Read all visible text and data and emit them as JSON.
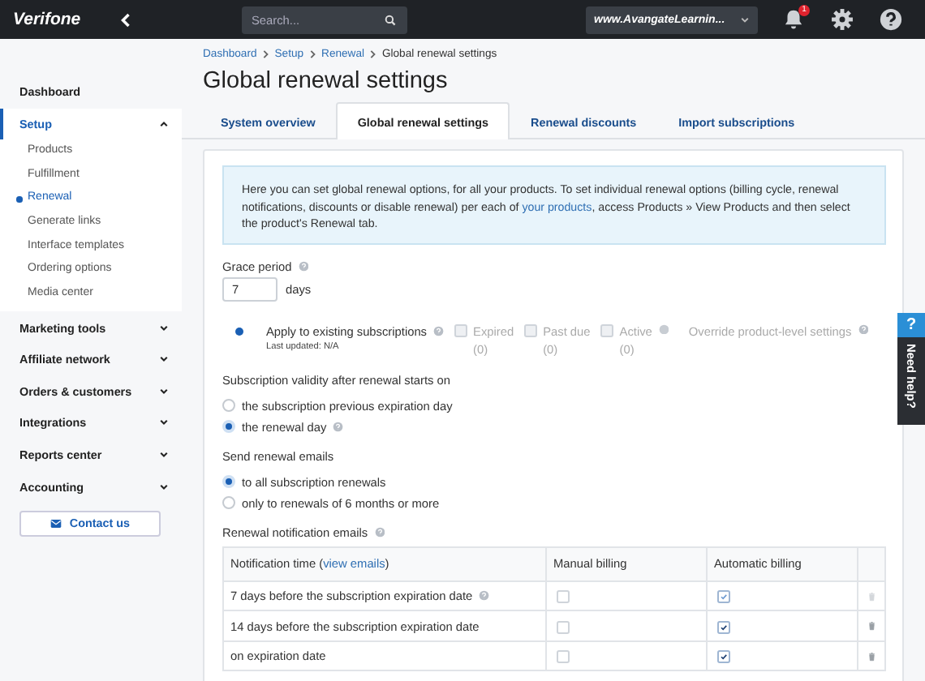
{
  "topbar": {
    "logo": "Verifone",
    "search_placeholder": "Search...",
    "account": "www.AvangateLearnin...",
    "notification_count": "1"
  },
  "sidebar": {
    "items": [
      {
        "label": "Dashboard",
        "kind": "link",
        "selected": false
      },
      {
        "label": "Setup",
        "kind": "group",
        "selected": true,
        "expanded": true,
        "children": [
          {
            "label": "Products",
            "selected": false
          },
          {
            "label": "Fulfillment",
            "selected": false
          },
          {
            "label": "Renewal",
            "selected": true
          },
          {
            "label": "Generate links",
            "selected": false
          },
          {
            "label": "Interface templates",
            "selected": false
          },
          {
            "label": "Ordering options",
            "selected": false
          },
          {
            "label": "Media center",
            "selected": false
          }
        ]
      },
      {
        "label": "Marketing tools",
        "kind": "group",
        "selected": false,
        "expanded": false
      },
      {
        "label": "Affiliate network",
        "kind": "group",
        "selected": false,
        "expanded": false
      },
      {
        "label": "Orders & customers",
        "kind": "group",
        "selected": false,
        "expanded": false
      },
      {
        "label": "Integrations",
        "kind": "group",
        "selected": false,
        "expanded": false
      },
      {
        "label": "Reports center",
        "kind": "group",
        "selected": false,
        "expanded": false
      },
      {
        "label": "Accounting",
        "kind": "group",
        "selected": false,
        "expanded": false
      }
    ],
    "contact_button": "Contact us"
  },
  "breadcrumb": [
    "Dashboard",
    "Setup",
    "Renewal",
    "Global renewal settings"
  ],
  "title": "Global renewal settings",
  "tabs": [
    {
      "label": "System overview",
      "selected": false
    },
    {
      "label": "Global renewal settings",
      "selected": true
    },
    {
      "label": "Renewal discounts",
      "selected": false
    },
    {
      "label": "Import subscriptions",
      "selected": false
    }
  ],
  "info": {
    "text_before": "Here you can set global renewal options, for all your products. To set individual renewal options (billing cycle, renewal notifications, discounts or disable renewal) per each of ",
    "link": "your products",
    "text_after": ", access Products » View Products and then select the product's Renewal tab."
  },
  "grace_period": {
    "label": "Grace period",
    "value": "7",
    "unit": "days"
  },
  "apply": {
    "label": "Apply to existing subscriptions",
    "note": "Last updated: N/A",
    "options": [
      {
        "label": "Expired",
        "count": "(0)",
        "checked": false,
        "disabled": true
      },
      {
        "label": "Past due",
        "count": "(0)",
        "checked": false,
        "disabled": true
      },
      {
        "label": "Active",
        "count": "(0)",
        "checked": false,
        "disabled": true
      }
    ],
    "override": "Override product-level settings"
  },
  "validity": {
    "label": "Subscription validity after renewal starts on",
    "options": [
      {
        "label": "the subscription previous expiration day",
        "selected": false,
        "help": false
      },
      {
        "label": "the renewal day",
        "selected": true,
        "help": true
      }
    ]
  },
  "send_emails": {
    "label": "Send renewal emails",
    "options": [
      {
        "label": "to all subscription renewals",
        "selected": true
      },
      {
        "label": "only to renewals of 6 months or more",
        "selected": false
      }
    ]
  },
  "notifications": {
    "label": "Renewal notification emails",
    "time_header": {
      "text_before": "Notification time (",
      "link": "view emails",
      "text_after": ")"
    },
    "columns": [
      "Manual billing",
      "Automatic billing"
    ],
    "rows": [
      {
        "time": "7 days before the subscription expiration date",
        "help": true,
        "manual": false,
        "automatic": true,
        "disabled": true
      },
      {
        "time": "14 days before the subscription expiration date",
        "help": false,
        "manual": false,
        "automatic": true,
        "disabled": false
      },
      {
        "time": "on expiration date",
        "help": false,
        "manual": false,
        "automatic": true,
        "disabled": false
      }
    ]
  },
  "help_tab": {
    "icon": "?",
    "label": "Need help?"
  }
}
